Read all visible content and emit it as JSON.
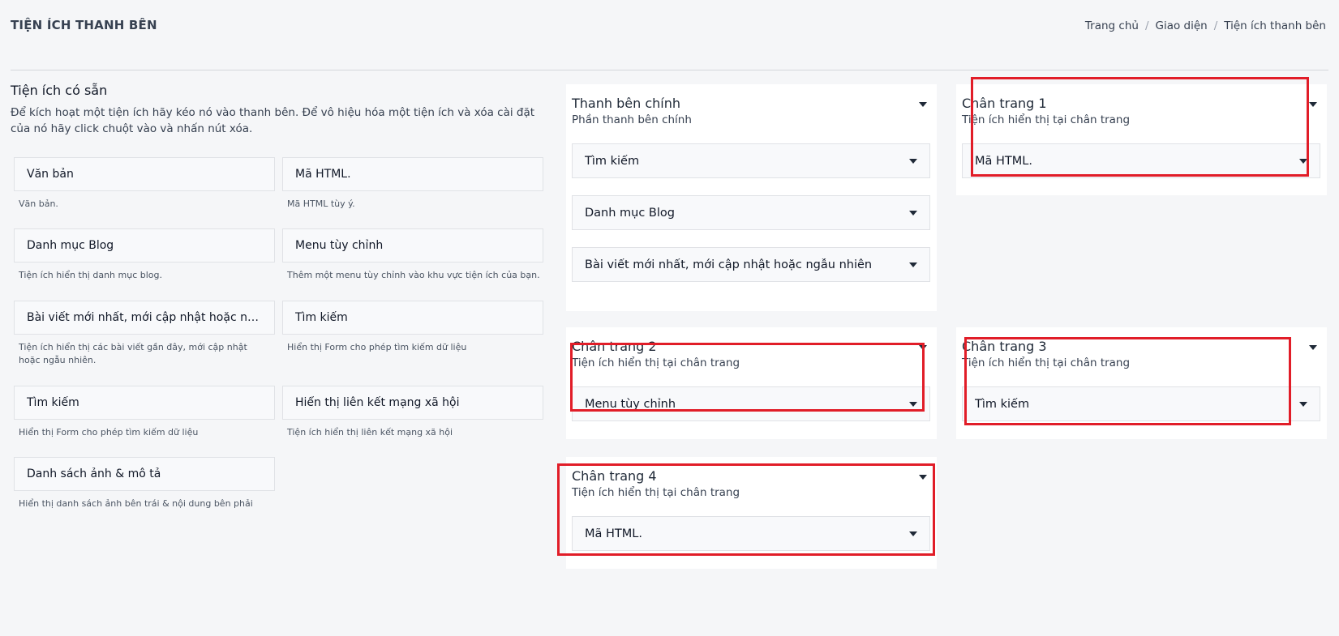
{
  "header": {
    "title": "TIỆN ÍCH THANH BÊN",
    "breadcrumb": [
      "Trang chủ",
      "Giao diện",
      "Tiện ích thanh bên"
    ]
  },
  "available": {
    "heading": "Tiện ích có sẵn",
    "description": "Để kích hoạt một tiện ích hãy kéo nó vào thanh bên. Để vô hiệu hóa một tiện ích và xóa cài đặt của nó hãy click chuột vào và nhấn nút xóa.",
    "widgets": [
      {
        "name": "Văn bản",
        "desc": "Văn bản."
      },
      {
        "name": "Mã HTML.",
        "desc": "Mã HTML tùy ý."
      },
      {
        "name": "Danh mục Blog",
        "desc": "Tiện ích hiển thị danh mục blog."
      },
      {
        "name": "Menu tùy chỉnh",
        "desc": "Thêm một menu tùy chỉnh vào khu vực tiện ích của bạn."
      },
      {
        "name": "Bài viết mới nhất, mới cập nhật hoặc ngẫu nhiên",
        "desc": "Tiện ích hiển thị các bài viết gần đây, mới cập nhật hoặc ngẫu nhiên."
      },
      {
        "name": "Tìm kiếm",
        "desc": "Hiển thị Form cho phép tìm kiếm dữ liệu"
      },
      {
        "name": "Tìm kiếm",
        "desc": "Hiển thị Form cho phép tìm kiếm dữ liệu"
      },
      {
        "name": "Hiển thị liên kết mạng xã hội",
        "desc": "Tiện ích hiển thị liên kết mạng xã hội"
      },
      {
        "name": "Danh sách ảnh & mô tả",
        "desc": "Hiển thị danh sách ảnh bên trái & nội dung bên phải"
      }
    ]
  },
  "sidebars": {
    "main": {
      "title": "Thanh bên chính",
      "subtitle": "Phần thanh bên chính",
      "items": [
        "Tìm kiếm",
        "Danh mục Blog",
        "Bài viết mới nhất, mới cập nhật hoặc ngẫu nhiên"
      ]
    },
    "footer1": {
      "title": "Chân trang 1",
      "subtitle": "Tiện ích hiển thị tại chân trang",
      "items": [
        "Mã HTML."
      ]
    },
    "footer2": {
      "title": "Chân trang 2",
      "subtitle": "Tiện ích hiển thị tại chân trang",
      "items": [
        "Menu tùy chỉnh"
      ]
    },
    "footer3": {
      "title": "Chân trang 3",
      "subtitle": "Tiện ích hiển thị tại chân trang",
      "items": [
        "Tìm kiếm"
      ]
    },
    "footer4": {
      "title": "Chân trang 4",
      "subtitle": "Tiện ích hiển thị tại chân trang",
      "items": [
        "Mã HTML."
      ]
    }
  },
  "colors": {
    "highlight": "#e11d28",
    "background": "#f5f6f8"
  }
}
